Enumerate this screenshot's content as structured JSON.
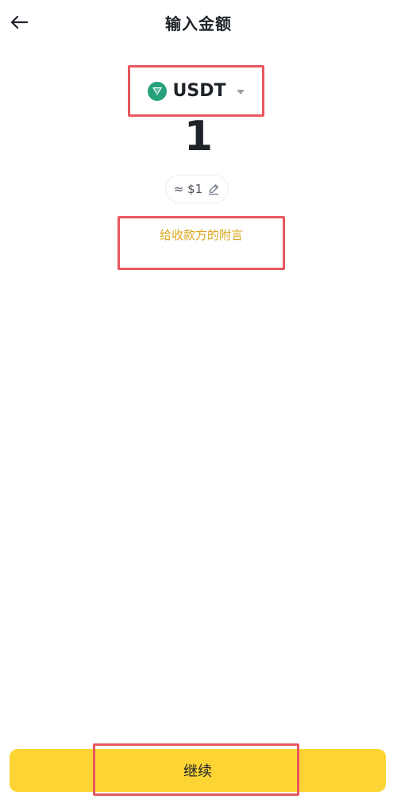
{
  "header": {
    "title": "输入金额",
    "back_icon": "arrow-left-icon"
  },
  "currency": {
    "code": "USDT",
    "icon": "tether-icon",
    "icon_color": "#26a17b",
    "dropdown_icon": "caret-down-icon"
  },
  "amount": {
    "value": "1"
  },
  "fiat": {
    "approx": "≈ $1",
    "edit_icon": "pencil-icon"
  },
  "memo": {
    "placeholder": "给收款方的附言",
    "color": "#d9a51a"
  },
  "footer": {
    "continue_label": "继续",
    "button_color": "#fcd535"
  },
  "highlight_color": "#e8575f"
}
